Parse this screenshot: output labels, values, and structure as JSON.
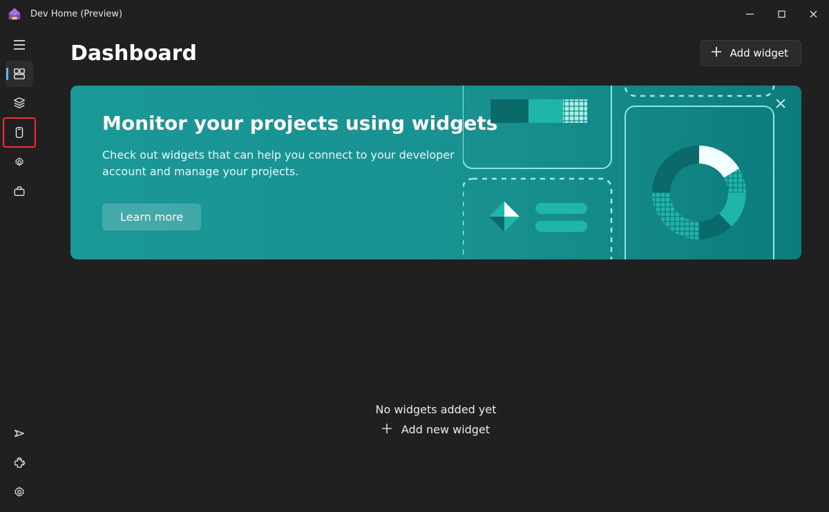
{
  "window": {
    "title": "Dev Home (Preview)"
  },
  "header": {
    "page_title": "Dashboard",
    "add_widget_label": "Add widget"
  },
  "banner": {
    "title": "Monitor your projects using widgets",
    "description": "Check out widgets that can help you connect to your developer account and manage your projects.",
    "learn_more_label": "Learn more"
  },
  "empty_state": {
    "title": "No widgets added yet",
    "action_label": "Add new widget"
  },
  "sidebar": {
    "items": {
      "menu": "Menu",
      "dashboard": "Dashboard",
      "stack": "Machine configuration",
      "device": "Environments",
      "settings_small": "Dev settings",
      "toolbox": "Utilities"
    },
    "bottom": {
      "feedback": "Feedback",
      "extensions": "Extensions",
      "settings": "Settings"
    }
  }
}
